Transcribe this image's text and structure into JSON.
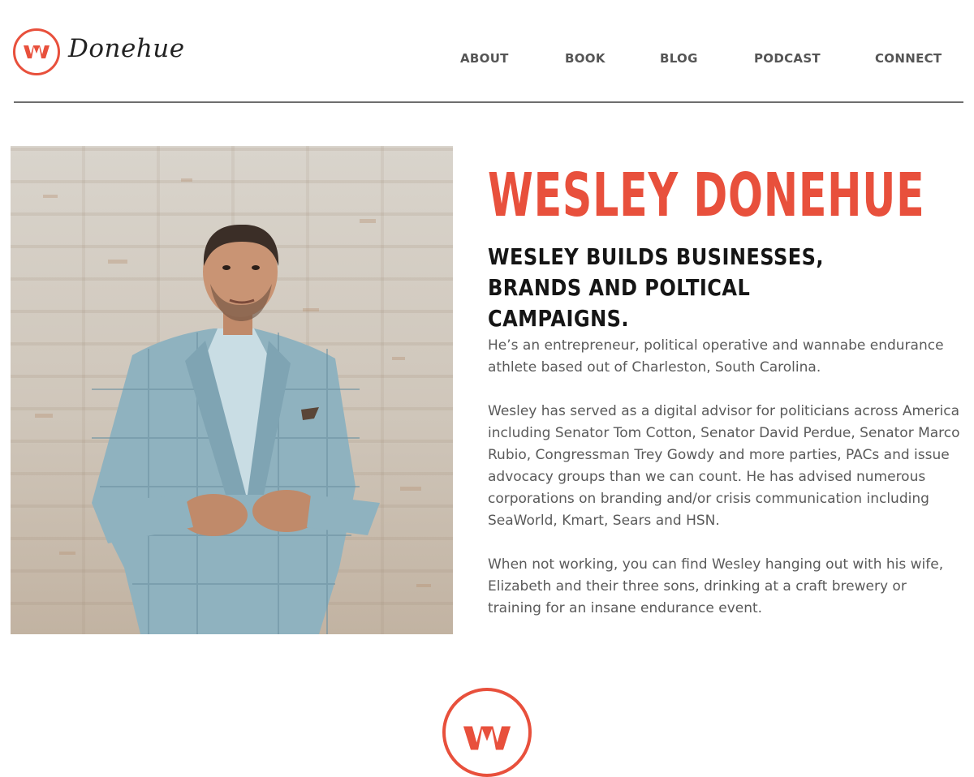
{
  "brand": {
    "script_name": "Donehue",
    "accent_color": "#e8503c"
  },
  "nav": {
    "items": [
      "ABOUT",
      "BOOK",
      "BLOG",
      "PODCAST",
      "CONNECT"
    ]
  },
  "hero": {
    "title": "WESLEY DONEHUE",
    "subtitle": "WESLEY BUILDS BUSINESSES, BRANDS AND POLTICAL CAMPAIGNS.",
    "paragraphs": [
      "He’s an entrepreneur, political operative and wannabe endurance athlete based out of Charleston, South Carolina.",
      "Wesley has served as a digital advisor for politicians across America including Senator Tom Cotton, Senator David Perdue, Senator Marco Rubio, Congressman Trey Gowdy and more parties, PACs and issue advocacy groups than we can count. He has advised numerous corporations on branding and/or crisis communication including SeaWorld, Kmart, Sears and HSN.",
      "When not working, you can find Wesley hanging out with his wife, Elizabeth and their three sons, drinking at a craft brewery or training for an insane endurance event."
    ]
  },
  "photo": {
    "subject": "portrait-man-plaid-blazer"
  }
}
